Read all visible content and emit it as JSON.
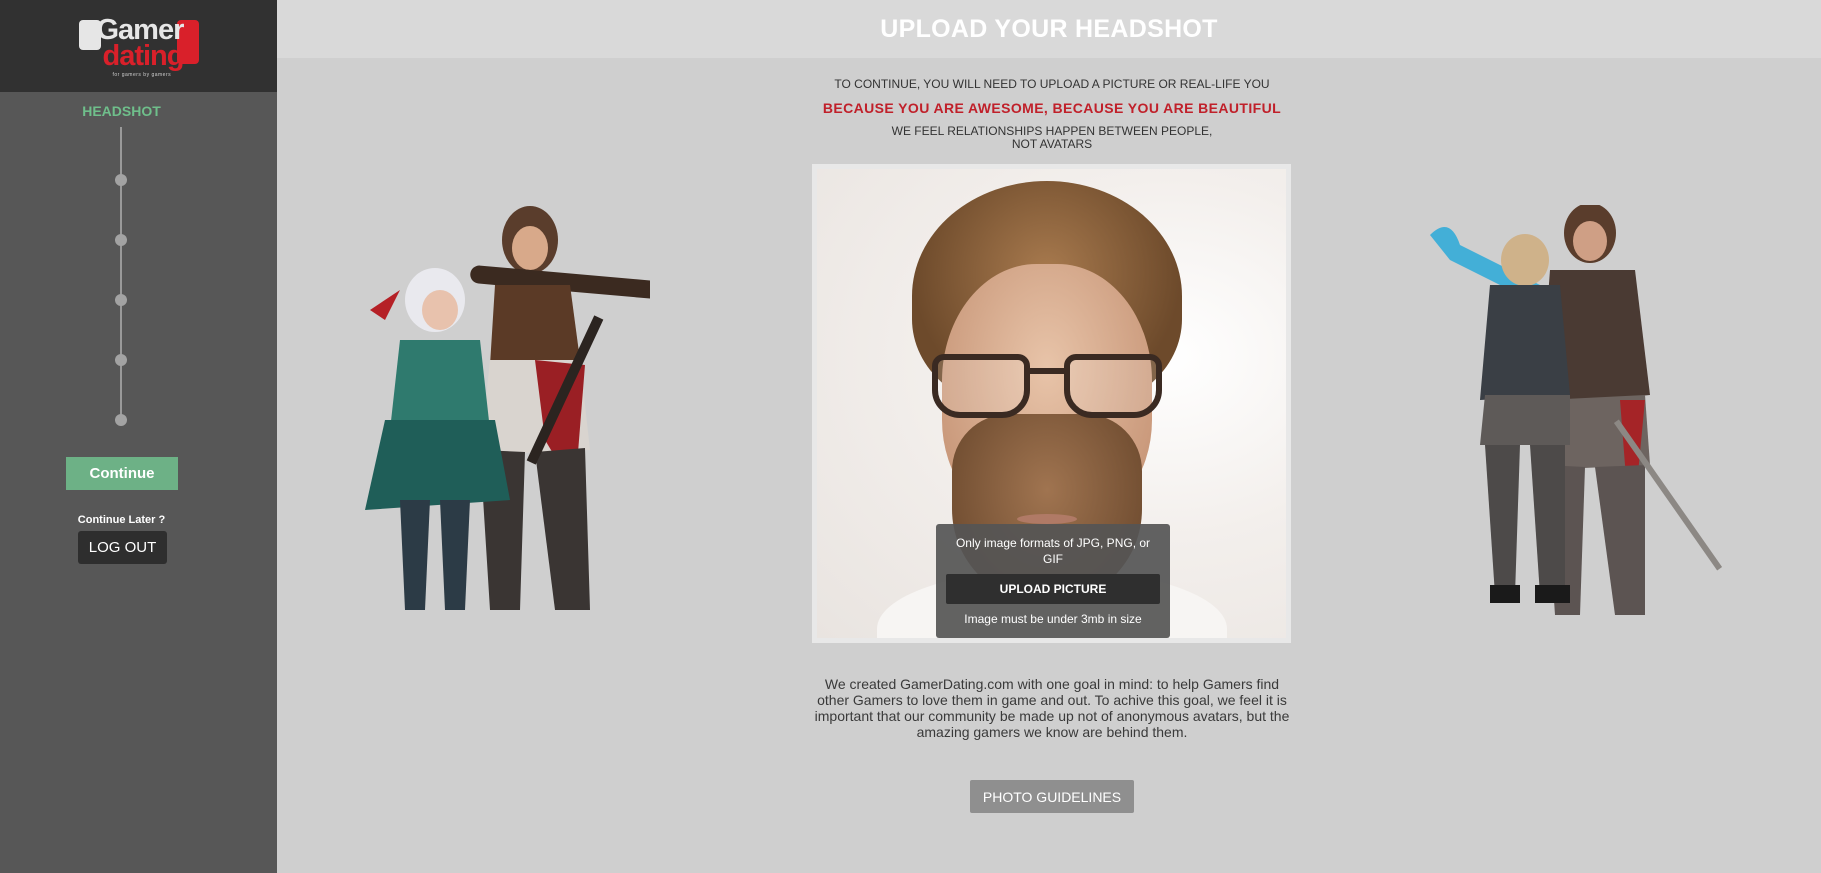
{
  "brand": {
    "logo_line1": "Gamer",
    "logo_line2": "dating",
    "logo_tagline": "for gamers by gamers"
  },
  "sidebar": {
    "step_title": "HEADSHOT",
    "steps_total": 6,
    "continue_label": "Continue",
    "continue_later_label": "Continue Later ?",
    "logout_label": "LOG OUT"
  },
  "header": {
    "title": "UPLOAD YOUR HEADSHOT"
  },
  "intro": {
    "line1": "TO CONTINUE, YOU WILL NEED TO UPLOAD A PICTURE OR REAL-LIFE YOU",
    "line2": "BECAUSE YOU ARE AWESOME, BECAUSE YOU ARE BEAUTIFUL",
    "line3a": "WE FEEL RELATIONSHIPS HAPPEN BETWEEN PEOPLE,",
    "line3b": "NOT AVATARS"
  },
  "upload": {
    "formats_text": "Only image formats of JPG, PNG, or GIF",
    "button_label": "UPLOAD PICTURE",
    "size_text": "Image must be under 3mb in size"
  },
  "description": "We created GamerDating.com with one goal in mind: to help Gamers find other Gamers to love them in game and out. To achive this goal, we feel it is important that our community be made up not of anonymous avatars, but the amazing gamers we know are behind them.",
  "guidelines_label": "PHOTO GUIDELINES",
  "colors": {
    "accent_green": "#6db186",
    "accent_red": "#c0202a",
    "sidebar_bg": "#575757",
    "page_bg": "#cfcfcf"
  }
}
